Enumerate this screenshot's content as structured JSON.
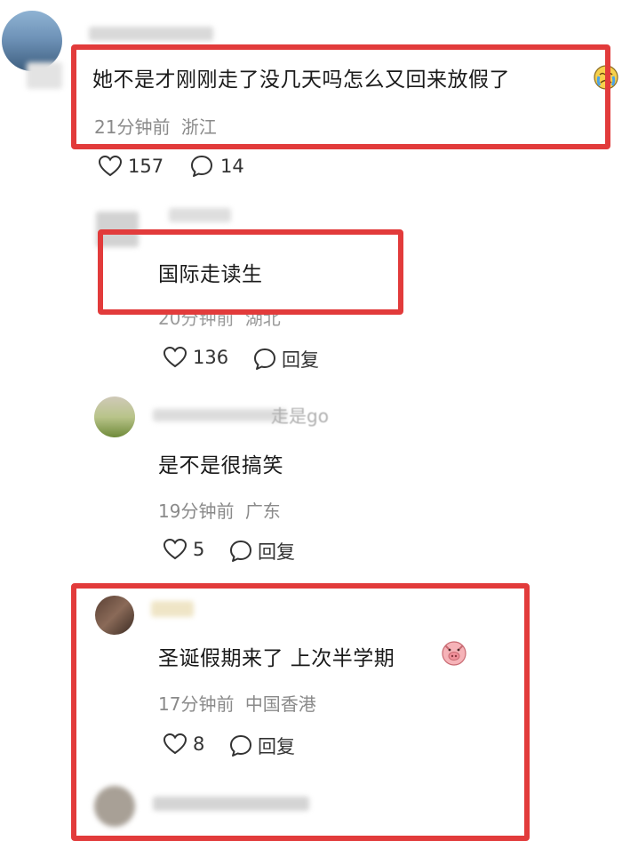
{
  "comments": [
    {
      "text": "她不是才刚刚走了没几天吗怎么又回来放假了",
      "time": "21分钟前",
      "location": "浙江",
      "likes": "157",
      "replies": "14"
    },
    {
      "text": "国际走读生",
      "time": "20分钟前",
      "location": "湖北",
      "likes": "136",
      "reply_label": "回复"
    },
    {
      "username_fragment": "走是go",
      "text": "是不是很搞笑",
      "time": "19分钟前",
      "location": "广东",
      "likes": "5",
      "reply_label": "回复"
    },
    {
      "text": "圣诞假期来了 上次半学期",
      "time": "17分钟前",
      "location": "中国香港",
      "likes": "8",
      "reply_label": "回复"
    }
  ],
  "colors": {
    "highlight_border": "#e23b3b",
    "meta_text": "#8a8a8a",
    "main_text": "#1a1a1a"
  }
}
